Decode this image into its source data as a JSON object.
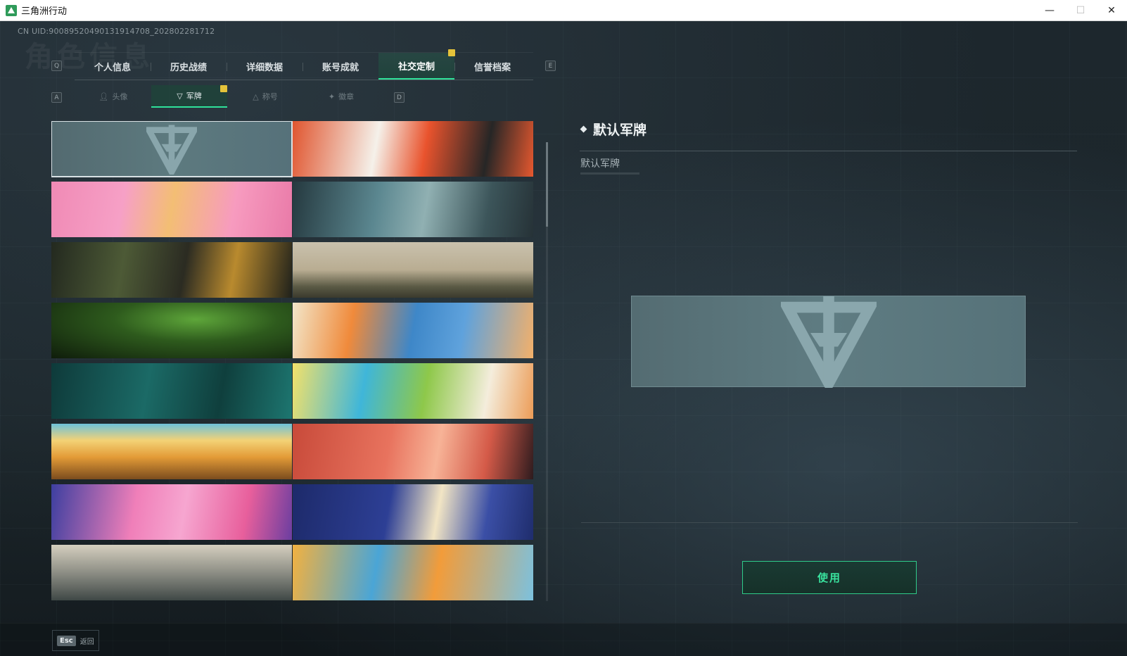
{
  "window": {
    "title": "三角洲行动",
    "minimize": "—",
    "maximize": "☐",
    "close": "✕"
  },
  "header": {
    "uid": "CN UID:9008952049013191470​8_202802281712",
    "ghost_title": "角色信息"
  },
  "keys": {
    "tab_prev": "Q",
    "tab_next": "E",
    "sub_prev": "A",
    "sub_next": "D"
  },
  "tabs": [
    {
      "label": "个人信息"
    },
    {
      "label": "历史战绩"
    },
    {
      "label": "详细数据"
    },
    {
      "label": "账号成就"
    },
    {
      "label": "社交定制",
      "active": true
    },
    {
      "label": "信誉档案"
    }
  ],
  "subtabs": [
    {
      "label": "头像",
      "icon": "person-icon"
    },
    {
      "label": "军牌",
      "icon": "plate-icon",
      "active": true
    },
    {
      "label": "称号",
      "icon": "title-icon"
    },
    {
      "label": "徽章",
      "icon": "badge-icon"
    }
  ],
  "plates": [
    {
      "name": "default-plate",
      "selected": true
    },
    {
      "name": "plate-anime-orange"
    },
    {
      "name": "plate-cats-pink"
    },
    {
      "name": "plate-helicopter-teal"
    },
    {
      "name": "plate-weapons-table"
    },
    {
      "name": "plate-sniper-desert"
    },
    {
      "name": "plate-green-nightvision"
    },
    {
      "name": "plate-orange-blue-art"
    },
    {
      "name": "plate-gym-teal"
    },
    {
      "name": "plate-music-anime"
    },
    {
      "name": "plate-desert-surreal"
    },
    {
      "name": "plate-sunset-girl"
    },
    {
      "name": "plate-pink-city"
    },
    {
      "name": "plate-night-chibi"
    },
    {
      "name": "plate-beach"
    },
    {
      "name": "plate-colorful-street"
    }
  ],
  "detail": {
    "title": "默认军牌",
    "subtitle": "默认军牌"
  },
  "actions": {
    "use_label": "使用",
    "back_key": "Esc",
    "back_label": "返回"
  },
  "colors": {
    "accent": "#2fe29a",
    "badge": "#e5c33a"
  }
}
